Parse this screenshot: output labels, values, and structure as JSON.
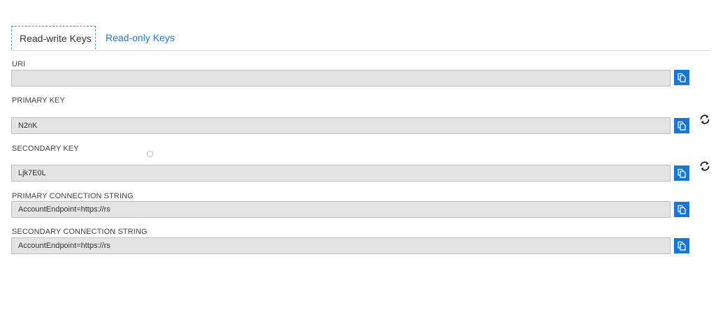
{
  "tabs": [
    {
      "label": "Read-write Keys",
      "active": true
    },
    {
      "label": "Read-only Keys",
      "active": false
    }
  ],
  "fields": {
    "uri": {
      "label": "URI",
      "value": ""
    },
    "primary_key": {
      "label": "PRIMARY KEY",
      "value": "N2nK"
    },
    "secondary_key": {
      "label": "SECONDARY KEY",
      "value": "Ljk7E0L"
    },
    "primary_connection_string": {
      "label": "PRIMARY CONNECTION STRING",
      "value": "AccountEndpoint=https://rs"
    },
    "secondary_connection_string": {
      "label": "SECONDARY CONNECTION STRING",
      "value": "AccountEndpoint=https://rs"
    }
  },
  "icons": {
    "copy": "copy-icon",
    "regenerate": "refresh-icon"
  },
  "colors": {
    "accent": "#1777d2",
    "tab_link": "#1e78c8",
    "input_background": "#e4e4e4",
    "input_border": "#bdbdbd"
  }
}
